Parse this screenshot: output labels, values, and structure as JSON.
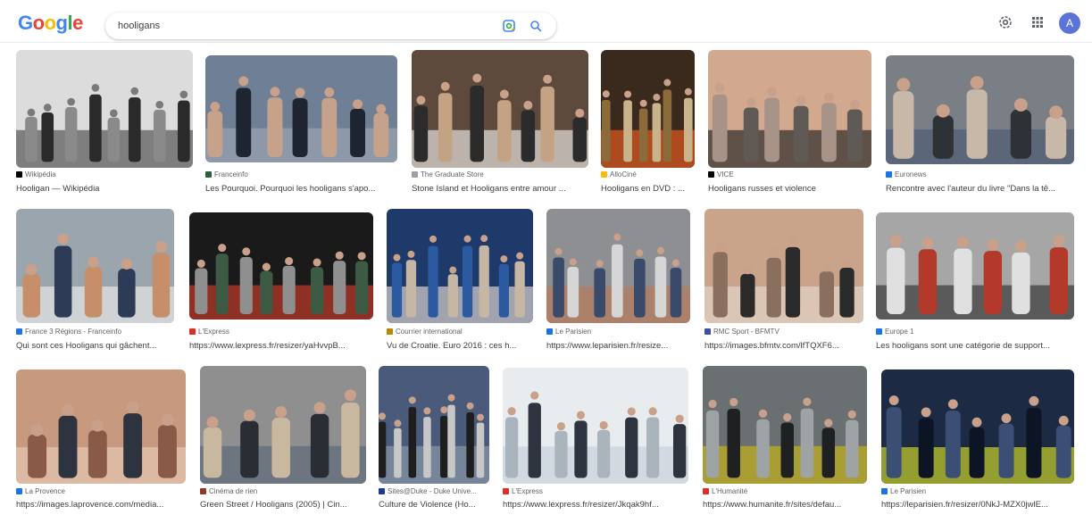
{
  "header": {
    "logo_letters": [
      "G",
      "o",
      "o",
      "g",
      "l",
      "e"
    ],
    "logo_colors": [
      "#4285f4",
      "#ea4335",
      "#fbbc05",
      "#4285f4",
      "#34a853",
      "#ea4335"
    ],
    "search_value": "hooligans",
    "avatar_letter": "A"
  },
  "results": [
    {
      "source": "Wikipédia",
      "caption": "Hooligan — Wikipédia",
      "icon": "wikipedia-favicon",
      "color": "#000000",
      "palette": [
        "#dcdcdc",
        "#2a2a2a",
        "#8a8a8a",
        "#555555"
      ],
      "grayscale": true
    },
    {
      "source": "Franceinfo",
      "caption": "Les Pourquoi. Pourquoi les hooligans s'apo...",
      "icon": "franceinfo-favicon",
      "color": "#2c5f3a",
      "palette": [
        "#6f7f95",
        "#1e2430",
        "#c7a28a",
        "#9aa3b0"
      ]
    },
    {
      "source": "The Graduate Store",
      "caption": "Stone Island et Hooligans entre amour ...",
      "icon": "graduate-store-favicon",
      "color": "#9aa0a6",
      "palette": [
        "#5d4a3c",
        "#c3a384",
        "#2b2b2b",
        "#e6e1dc"
      ]
    },
    {
      "source": "AlloCiné",
      "caption": "Hooligans en DVD : ...",
      "icon": "allocine-favicon",
      "color": "#fbbc05",
      "palette": [
        "#3a2a1d",
        "#c9b38b",
        "#8c6b3a",
        "#e05a1f"
      ]
    },
    {
      "source": "VICE",
      "caption": "Hooligans russes et violence",
      "icon": "vice-favicon",
      "color": "#000000",
      "palette": [
        "#d2a98f",
        "#5f5a56",
        "#a89388",
        "#2e2b2a"
      ]
    },
    {
      "source": "Euronews",
      "caption": "Rencontre avec l'auteur du livre \"Dans la tê...",
      "icon": "euronews-favicon",
      "color": "#1a73e8",
      "palette": [
        "#7a7f86",
        "#2e3136",
        "#c7b8a8",
        "#4f5d73"
      ]
    },
    {
      "source": "France 3 Régions - Franceinfo",
      "caption": "Qui sont ces Hooligans qui gâchent...",
      "icon": "france3-favicon",
      "color": "#1a73e8",
      "palette": [
        "#9aa5ae",
        "#2d3b57",
        "#c68f6a",
        "#e7e7e7"
      ]
    },
    {
      "source": "L'Express",
      "caption": "https://www.lexpress.fr/resizer/yaHvvpB...",
      "icon": "lexpress-favicon",
      "color": "#d93025",
      "palette": [
        "#1a1a1a",
        "#3d5a44",
        "#8f8f8f",
        "#c23a2b"
      ]
    },
    {
      "source": "Courrier international",
      "caption": "Vu de Croatie. Euro 2016 : ces h...",
      "icon": "courrier-international-favicon",
      "color": "#b58900",
      "palette": [
        "#1e3a6b",
        "#c6b7a4",
        "#2b5aa0",
        "#d8d2cc"
      ]
    },
    {
      "source": "Le Parisien",
      "caption": "https://www.leparisien.fr/resize...",
      "icon": "leparisien-favicon",
      "color": "#1a73e8",
      "palette": [
        "#8d8f93",
        "#d6d6d6",
        "#3a4a6a",
        "#b87a5a"
      ]
    },
    {
      "source": "RMC Sport - BFMTV",
      "caption": "https://images.bfmtv.com/lfTQXF6...",
      "icon": "rmc-sport-favicon",
      "color": "#3c4ea8",
      "palette": [
        "#c9a38a",
        "#2a2a2a",
        "#8a6f5e",
        "#e3d4c8"
      ]
    },
    {
      "source": "Europe 1",
      "caption": "Les hooligans sont une catégorie de support...",
      "icon": "europe1-favicon",
      "color": "#1a73e8",
      "palette": [
        "#a6a6a6",
        "#b33a2a",
        "#e0e0e0",
        "#3b3b3b"
      ]
    },
    {
      "source": "La Provence",
      "caption": "https://images.laprovence.com/media...",
      "icon": "laprovence-favicon",
      "color": "#1a73e8",
      "palette": [
        "#c79a80",
        "#2d3440",
        "#8a5a48",
        "#e4c6b1"
      ]
    },
    {
      "source": "Cinéma de rien",
      "caption": "Green Street / Hooligans (2005) | Cin...",
      "icon": "cinema-de-rien-favicon",
      "color": "#8a3b2a",
      "palette": [
        "#8f8f8f",
        "#2a2d33",
        "#c9b8a0",
        "#5e6a7a"
      ]
    },
    {
      "source": "Sites@Duke - Duke Unive...",
      "caption": "Culture de Violence (Ho...",
      "icon": "duke-favicon",
      "color": "#1f3a93",
      "palette": [
        "#4a5a7a",
        "#c7c7c7",
        "#1e1e1e",
        "#8a97a8"
      ]
    },
    {
      "source": "L'Express",
      "caption": "https://www.lexpress.fr/resizer/Jkqak9hf...",
      "icon": "lexpress-favicon",
      "color": "#d93025",
      "palette": [
        "#e8ecef",
        "#2d3440",
        "#aab4bd",
        "#c9d2da"
      ]
    },
    {
      "source": "L'Humanité",
      "caption": "https://www.humanite.fr/sites/defau...",
      "icon": "humanite-favicon",
      "color": "#d93025",
      "palette": [
        "#6a6f72",
        "#1e2022",
        "#9ea3a6",
        "#c4b21a"
      ]
    },
    {
      "source": "Le Parisien",
      "caption": "https://leparisien.fr/resizer/0NkJ-MZX0jwlE...",
      "icon": "leparisien-favicon",
      "color": "#1a73e8",
      "palette": [
        "#1c2a44",
        "#0d1524",
        "#3a4f73",
        "#c8d02a"
      ]
    }
  ]
}
